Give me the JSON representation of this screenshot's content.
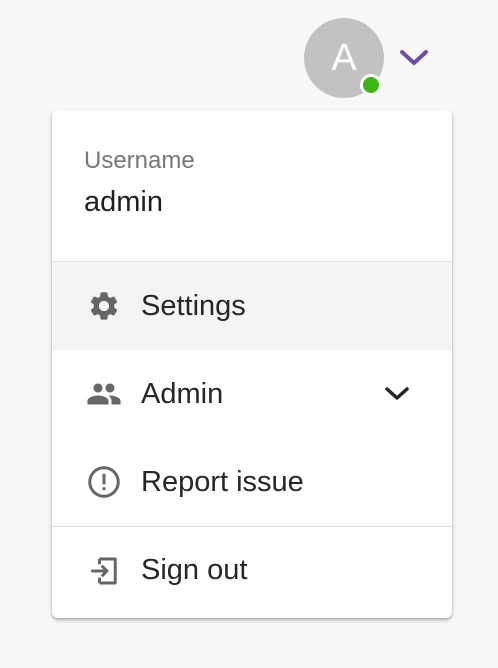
{
  "header": {
    "avatar_initial": "A",
    "status_color": "#3db515",
    "chevron_color": "#6b4fa6"
  },
  "menu": {
    "user": {
      "label": "Username",
      "value": "admin"
    },
    "items": [
      {
        "label": "Settings",
        "icon": "gear-icon",
        "active": true
      },
      {
        "label": "Admin",
        "icon": "users-icon",
        "has_submenu": true
      },
      {
        "label": "Report issue",
        "icon": "alert-circle-icon"
      },
      {
        "label": "Sign out",
        "icon": "sign-out-icon"
      }
    ]
  }
}
